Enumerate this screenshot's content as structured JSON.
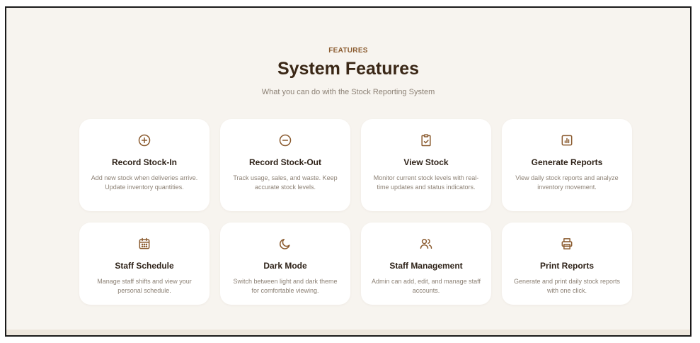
{
  "section": {
    "eyebrow": "FEATURES",
    "title": "System Features",
    "subtitle": "What you can do with the Stock Reporting System"
  },
  "colors": {
    "accent": "#8a5a2e",
    "heading": "#3a2716",
    "muted": "#8c8175",
    "background": "#f7f4ef",
    "card": "#ffffff"
  },
  "features": [
    {
      "icon": "plus-circle-icon",
      "title": "Record Stock-In",
      "description": "Add new stock when deliveries arrive. Update inventory quantities."
    },
    {
      "icon": "minus-circle-icon",
      "title": "Record Stock-Out",
      "description": "Track usage, sales, and waste. Keep accurate stock levels."
    },
    {
      "icon": "clipboard-check-icon",
      "title": "View Stock",
      "description": "Monitor current stock levels with real-time updates and status indicators."
    },
    {
      "icon": "bar-chart-icon",
      "title": "Generate Reports",
      "description": "View daily stock reports and analyze inventory movement."
    },
    {
      "icon": "calendar-icon",
      "title": "Staff Schedule",
      "description": "Manage staff shifts and view your personal schedule."
    },
    {
      "icon": "moon-icon",
      "title": "Dark Mode",
      "description": "Switch between light and dark theme for comfortable viewing."
    },
    {
      "icon": "users-icon",
      "title": "Staff Management",
      "description": "Admin can add, edit, and manage staff accounts."
    },
    {
      "icon": "printer-icon",
      "title": "Print Reports",
      "description": "Generate and print daily stock reports with one click."
    }
  ]
}
